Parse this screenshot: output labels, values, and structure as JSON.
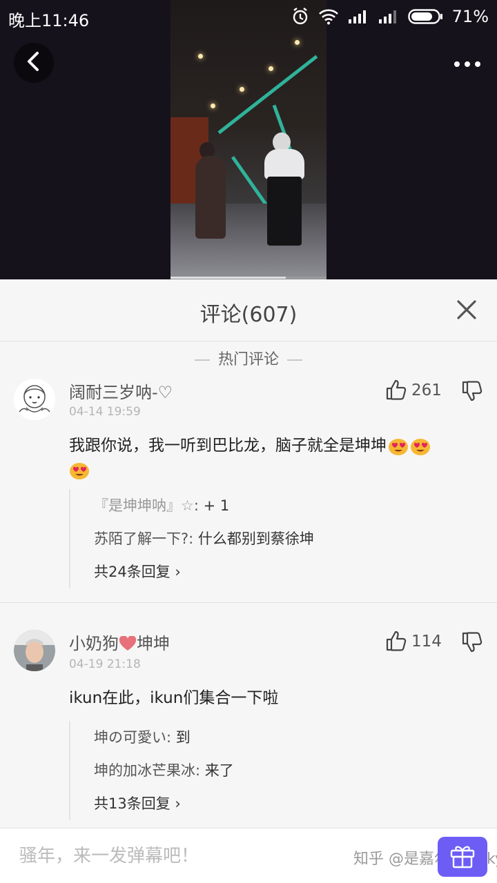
{
  "status_bar": {
    "time": "晚上11:46",
    "battery": "71%"
  },
  "video": {
    "progress": 0.74
  },
  "panel": {
    "title": "评论(607)",
    "section_label": "热门评论"
  },
  "comments": [
    {
      "username": "阔耐三岁呐-♡",
      "time": "04-14 19:59",
      "likes": "261",
      "content": "我跟你说，我一听到巴比龙，脑子就全是坤坤",
      "emoji_count": 3,
      "replies": [
        {
          "author": "『是坤坤呐』☆",
          "text": "+ 1"
        },
        {
          "author": "苏陌了解一下?",
          "text": "什么都别到蔡徐坤"
        }
      ],
      "more_replies": "共24条回复"
    },
    {
      "username_a": "小奶狗",
      "username_b": "坤坤",
      "time": "04-19 21:18",
      "likes": "114",
      "content": "ikun在此，ikun们集合一下啦",
      "replies": [
        {
          "author": "坤の可愛い",
          "text": "到"
        },
        {
          "author": "坤的加冰芒果冰",
          "text": "来了"
        }
      ],
      "more_replies": "共13条回复"
    }
  ],
  "bottom_bar": {
    "placeholder": "骚年，来一发弹幕吧！",
    "watermark": "知乎 @是嘉尔的Jacky"
  },
  "colors": {
    "accent": "#6d5df5",
    "heart": "#e8707a"
  },
  "icons": [
    "back-arrow-icon",
    "more-dots-icon",
    "close-icon",
    "thumb-up-icon",
    "thumb-down-icon",
    "gift-icon",
    "heart-icon",
    "alarm-icon",
    "wifi-icon",
    "signal-icon",
    "battery-icon"
  ]
}
